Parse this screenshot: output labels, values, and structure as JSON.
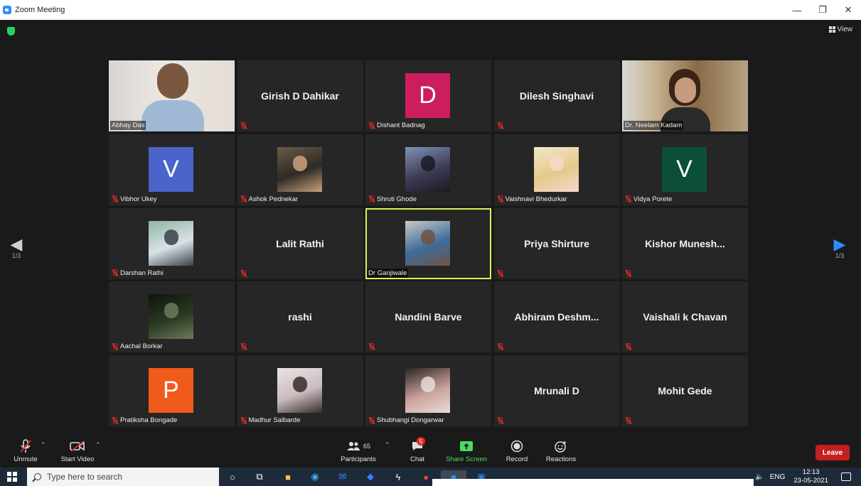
{
  "window": {
    "title": "Zoom Meeting",
    "controls": {
      "minimize": "—",
      "restore": "❐",
      "close": "✕"
    }
  },
  "header": {
    "view_label": "View"
  },
  "pagination": {
    "left": "1/3",
    "right": "1/3"
  },
  "participants": [
    {
      "name": "Abhay Das",
      "kind": "video",
      "muted": false,
      "display": ""
    },
    {
      "name": "",
      "kind": "name",
      "muted": true,
      "display": "Girish D Dahikar"
    },
    {
      "name": "Dishant Badnag",
      "kind": "letter",
      "letter": "D",
      "color": "#cc1d5e",
      "muted": true
    },
    {
      "name": "",
      "kind": "name",
      "muted": true,
      "display": "Dilesh Singhavi"
    },
    {
      "name": "Dr. Neelam Kadam",
      "kind": "video",
      "muted": false,
      "display": ""
    },
    {
      "name": "Vibhor Ukey",
      "kind": "letter",
      "letter": "V",
      "color": "#4b64c9",
      "muted": true
    },
    {
      "name": "Ashok Pednekar",
      "kind": "photo",
      "muted": true
    },
    {
      "name": "Shruti Ghode",
      "kind": "photo",
      "muted": true
    },
    {
      "name": "Vaishnavi Bhedurkar",
      "kind": "photo",
      "muted": true
    },
    {
      "name": "Vidya Porete",
      "kind": "letter",
      "letter": "V",
      "color": "#0b4f3a",
      "muted": true
    },
    {
      "name": "Darshan Rathi",
      "kind": "photo",
      "muted": true
    },
    {
      "name": "",
      "kind": "name",
      "muted": true,
      "display": "Lalit Rathi"
    },
    {
      "name": "Dr Ganjiwale",
      "kind": "photo",
      "muted": false,
      "active": true
    },
    {
      "name": "",
      "kind": "name",
      "muted": true,
      "display": "Priya Shirture"
    },
    {
      "name": "",
      "kind": "name",
      "muted": true,
      "display": "Kishor  Munesh..."
    },
    {
      "name": "Aachal Borkar",
      "kind": "photo",
      "muted": true
    },
    {
      "name": "",
      "kind": "name",
      "muted": true,
      "display": "rashi"
    },
    {
      "name": "",
      "kind": "name",
      "muted": true,
      "display": "Nandini Barve"
    },
    {
      "name": "",
      "kind": "name",
      "muted": true,
      "display": "Abhiram  Deshm..."
    },
    {
      "name": "",
      "kind": "name",
      "muted": true,
      "display": "Vaishali k Chavan"
    },
    {
      "name": "Pratiksha Bongade",
      "kind": "letter",
      "letter": "P",
      "color": "#f05a1a",
      "muted": true
    },
    {
      "name": "Madhur Salbarde",
      "kind": "photo",
      "muted": true
    },
    {
      "name": "Shubhangi Dongarwar",
      "kind": "photo",
      "muted": true
    },
    {
      "name": "",
      "kind": "name",
      "muted": true,
      "display": "Mrunali D"
    },
    {
      "name": "",
      "kind": "name",
      "muted": true,
      "display": "Mohit Gede"
    }
  ],
  "toolbar": {
    "unmute": "Unmute",
    "start_video": "Start Video",
    "participants": "Participants",
    "participants_count": "65",
    "chat": "Chat",
    "chat_badge": "5",
    "share_screen": "Share Screen",
    "record": "Record",
    "reactions": "Reactions",
    "leave": "Leave"
  },
  "taskbar": {
    "search_placeholder": "Type here to search",
    "lang": "ENG",
    "time": "12:13",
    "date": "23-05-2021",
    "notif_count": "3"
  },
  "colors": {
    "active_speaker": "#d7f35b",
    "leave": "#c41f1f",
    "zoom_blue": "#2d8cff"
  }
}
